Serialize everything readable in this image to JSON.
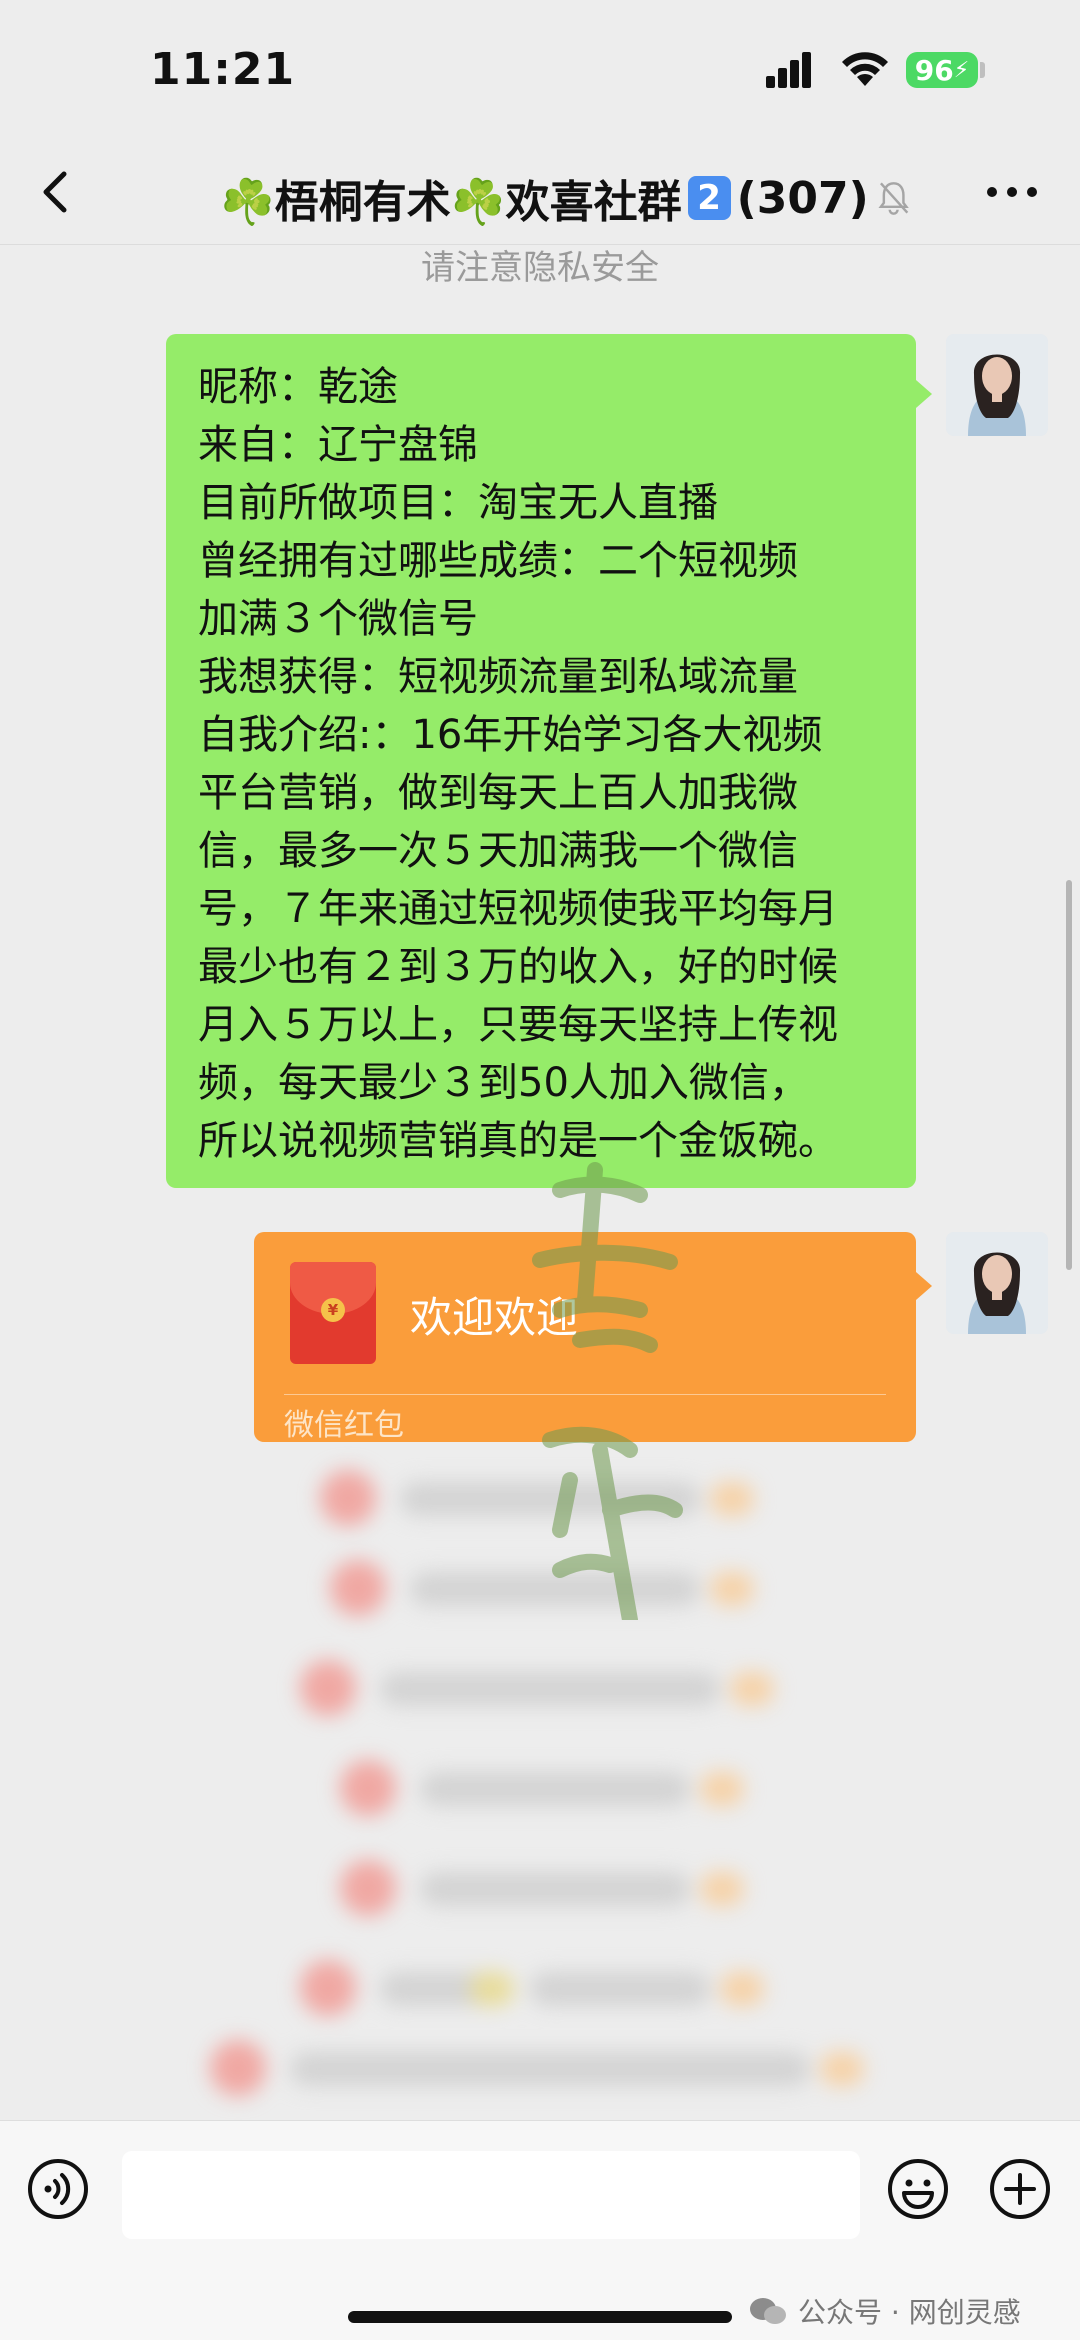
{
  "status_bar": {
    "time": "11:21",
    "battery": "96"
  },
  "header": {
    "title_prefix": "☘️梧桐有术☘️欢喜社群",
    "badge": "2",
    "member_count": "(307)"
  },
  "notice": "请注意隐私安全",
  "messages": [
    {
      "type": "text",
      "lines": [
        "昵称：乾途",
        "来自：辽宁盘锦",
        "目前所做项目：淘宝无人直播",
        "曾经拥有过哪些成绩：二个短视频",
        "加满３个微信号",
        "我想获得：短视频流量到私域流量",
        "自我介绍:：16年开始学习各大视频",
        "平台营销，做到每天上百人加我微",
        "信，最多一次５天加满我一个微信",
        "号，７年来通过短视频使我平均每月",
        "最少也有２到３万的收入，好的时候",
        "月入５万以上，只要每天坚持上传视",
        "频，每天最少３到50人加入微信，",
        "所以说视频营销真的是一个金饭碗。"
      ]
    },
    {
      "type": "red_packet",
      "title": "欢迎欢迎",
      "footer": "微信红包"
    }
  ],
  "footer": {
    "watermark": "公众号 · 网创灵感"
  },
  "colors": {
    "bubble_green": "#95ec69",
    "packet_orange": "#fa9d3b",
    "background": "#ededed"
  },
  "icons": [
    "back-chevron-icon",
    "mute-bell-icon",
    "more-dots-icon",
    "voice-icon",
    "emoji-icon",
    "add-icon",
    "wechat-icon"
  ]
}
